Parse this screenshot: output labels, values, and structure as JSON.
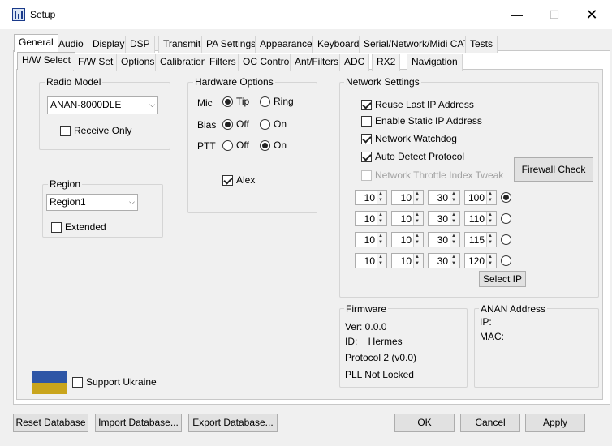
{
  "window": {
    "title": "Setup"
  },
  "titlebar_icons": {
    "minimize": "—",
    "maximize": "☐",
    "close": "✕"
  },
  "top_tabs": [
    "General",
    "Audio",
    "Display",
    "DSP",
    "Transmit",
    "PA Settings",
    "Appearance",
    "Keyboard",
    "Serial/Network/Midi CAT",
    "Tests"
  ],
  "sub_tabs": [
    "H/W Select",
    "F/W Set",
    "Options",
    "Calibration",
    "Filters",
    "OC Control",
    "Ant/Filters",
    "ADC",
    "RX2",
    "Navigation"
  ],
  "radio_model": {
    "title": "Radio Model",
    "selected": "ANAN-8000DLE",
    "receive_only": "Receive Only"
  },
  "hardware": {
    "title": "Hardware Options",
    "mic_label": "Mic",
    "mic_opt1": "Tip",
    "mic_opt2": "Ring",
    "bias_label": "Bias",
    "bias_opt1": "Off",
    "bias_opt2": "On",
    "ptt_label": "PTT",
    "ptt_opt1": "Off",
    "ptt_opt2": "On",
    "alex": "Alex"
  },
  "region": {
    "title": "Region",
    "selected": "Region1",
    "extended": "Extended"
  },
  "network": {
    "title": "Network Settings",
    "reuse_ip": "Reuse Last IP Address",
    "static_ip": "Enable Static IP Address",
    "watchdog": "Network Watchdog",
    "auto_detect": "Auto Detect Protocol",
    "throttle": "Network Throttle Index Tweak",
    "firewall": "Firewall Check",
    "select_ip": "Select IP",
    "ips": [
      [
        "10",
        "10",
        "30",
        "100"
      ],
      [
        "10",
        "10",
        "30",
        "110"
      ],
      [
        "10",
        "10",
        "30",
        "115"
      ],
      [
        "10",
        "10",
        "30",
        "120"
      ]
    ]
  },
  "firmware": {
    "title": "Firmware",
    "ver": "Ver:  0.0.0",
    "id": "ID:    Hermes",
    "protocol": "Protocol 2 (v0.0)",
    "pll": "PLL Not Locked"
  },
  "anan_address": {
    "title": "ANAN Address",
    "ip": "IP:",
    "mac": "MAC:"
  },
  "ukraine": {
    "label": "Support Ukraine",
    "color_top": "#2e56a6",
    "color_bottom": "#c9a51d"
  },
  "footer": {
    "reset": "Reset Database",
    "import": "Import Database...",
    "export": "Export Database...",
    "ok": "OK",
    "cancel": "Cancel",
    "apply": "Apply"
  }
}
